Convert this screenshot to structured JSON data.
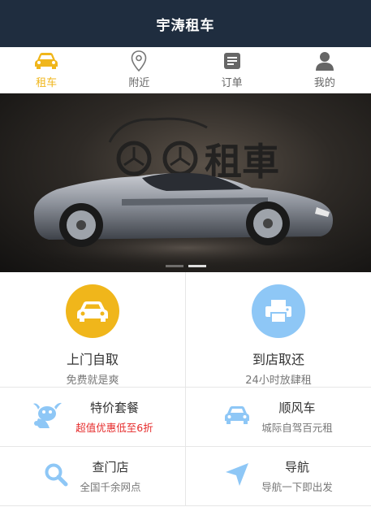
{
  "header": {
    "title": "宇涛租车"
  },
  "tabs": [
    {
      "label": "租车",
      "icon": "car-icon",
      "active": true
    },
    {
      "label": "附近",
      "icon": "location-pin-icon",
      "active": false
    },
    {
      "label": "订单",
      "icon": "order-list-icon",
      "active": false
    },
    {
      "label": "我的",
      "icon": "user-icon",
      "active": false
    }
  ],
  "banner": {
    "logo_text": "租車",
    "slides": 2,
    "active_slide": 2
  },
  "services": [
    {
      "title": "上门自取",
      "subtitle": "免费就是爽",
      "icon": "car-icon",
      "color": "#f0b61b"
    },
    {
      "title": "到店取还",
      "subtitle": "24小时放肆租",
      "icon": "printer-icon",
      "color": "#8ec7f6"
    }
  ],
  "features": [
    {
      "title": "特价套餐",
      "subtitle": "超值优惠低至6折",
      "icon": "bull-mascot-icon"
    },
    {
      "title": "顺风车",
      "subtitle": "城际自驾百元租",
      "icon": "car-icon"
    },
    {
      "title": "查门店",
      "subtitle": "全国千余网点",
      "icon": "search-icon"
    },
    {
      "title": "导航",
      "subtitle": "导航一下即出发",
      "icon": "navigation-arrow-icon"
    }
  ],
  "colors": {
    "header_bg": "#1f2d3f",
    "accent": "#f0b61b",
    "icon_blue": "#8ec7f6",
    "promo_red": "#e52929"
  }
}
